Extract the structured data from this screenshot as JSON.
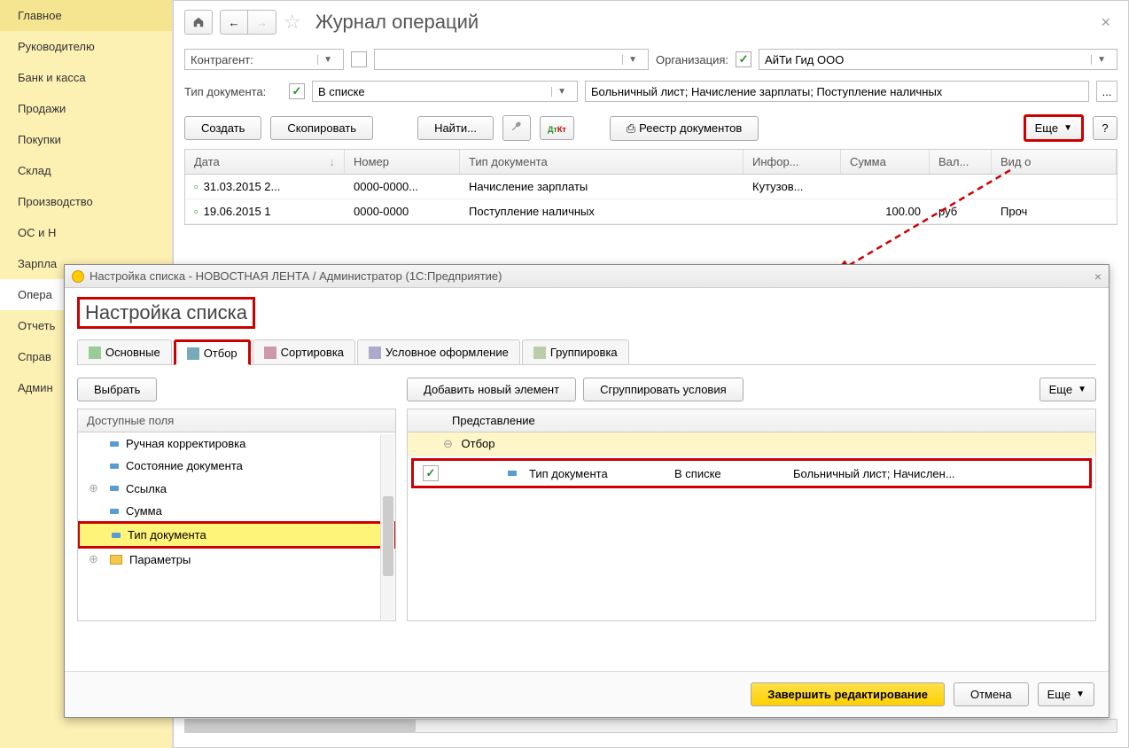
{
  "sidebar": {
    "items": [
      {
        "label": "Главное"
      },
      {
        "label": "Руководителю"
      },
      {
        "label": "Банк и касса"
      },
      {
        "label": "Продажи"
      },
      {
        "label": "Покупки"
      },
      {
        "label": "Склад"
      },
      {
        "label": "Производство"
      },
      {
        "label": "ОС и Н"
      },
      {
        "label": "Зарпла"
      },
      {
        "label": "Опера"
      },
      {
        "label": "Отчеть"
      },
      {
        "label": "Справ"
      },
      {
        "label": "Админ"
      }
    ],
    "active_index": 9
  },
  "header": {
    "title": "Журнал операций"
  },
  "filters": {
    "counterparty_label": "Контрагент:",
    "org_label": "Организация:",
    "org_value": "АйТи Гид ООО",
    "doctype_label": "Тип документа:",
    "doctype_mode": "В списке",
    "doctype_value": "Больничный лист; Начисление зарплаты; Поступление наличных",
    "ellipsis": "..."
  },
  "toolbar": {
    "create": "Создать",
    "copy": "Скопировать",
    "find": "Найти...",
    "registry": "Реестр документов",
    "more": "Еще",
    "help": "?"
  },
  "table": {
    "columns": {
      "date": "Дата",
      "number": "Номер",
      "doctype": "Тип документа",
      "info": "Инфор...",
      "sum": "Сумма",
      "currency": "Вал...",
      "kind": "Вид о"
    },
    "rows": [
      {
        "date": "31.03.2015 2...",
        "number": "0000-0000...",
        "doctype": "Начисление зарплаты",
        "info": "Кутузов...",
        "sum": "",
        "currency": "",
        "kind": ""
      },
      {
        "date": "19.06.2015 1",
        "number": "0000-0000",
        "doctype": "Поступление наличных",
        "info": "",
        "sum": "100.00",
        "currency": "руб",
        "kind": "Проч"
      }
    ]
  },
  "dialog": {
    "window_title": "Настройка списка - НОВОСТНАЯ ЛЕНТА / Администратор  (1С:Предприятие)",
    "title": "Настройка списка",
    "tabs": [
      {
        "label": "Основные"
      },
      {
        "label": "Отбор"
      },
      {
        "label": "Сортировка"
      },
      {
        "label": "Условное оформление"
      },
      {
        "label": "Группировка"
      }
    ],
    "active_tab": 1,
    "left": {
      "choose": "Выбрать",
      "header": "Доступные поля",
      "items": [
        {
          "label": "Ручная корректировка",
          "expand": ""
        },
        {
          "label": "Состояние документа",
          "expand": ""
        },
        {
          "label": "Ссылка",
          "expand": "+"
        },
        {
          "label": "Сумма",
          "expand": ""
        },
        {
          "label": "Тип документа",
          "expand": "",
          "highlight": true
        },
        {
          "label": "Параметры",
          "expand": "+",
          "folder": true
        }
      ]
    },
    "right": {
      "add": "Добавить новый элемент",
      "group": "Сгруппировать условия",
      "more": "Еще",
      "header": "Представление",
      "root": "Отбор",
      "row": {
        "field": "Тип документа",
        "mode": "В списке",
        "value": "Больничный лист; Начислен..."
      }
    },
    "footer": {
      "finish": "Завершить редактирование",
      "cancel": "Отмена",
      "more": "Еще"
    }
  }
}
